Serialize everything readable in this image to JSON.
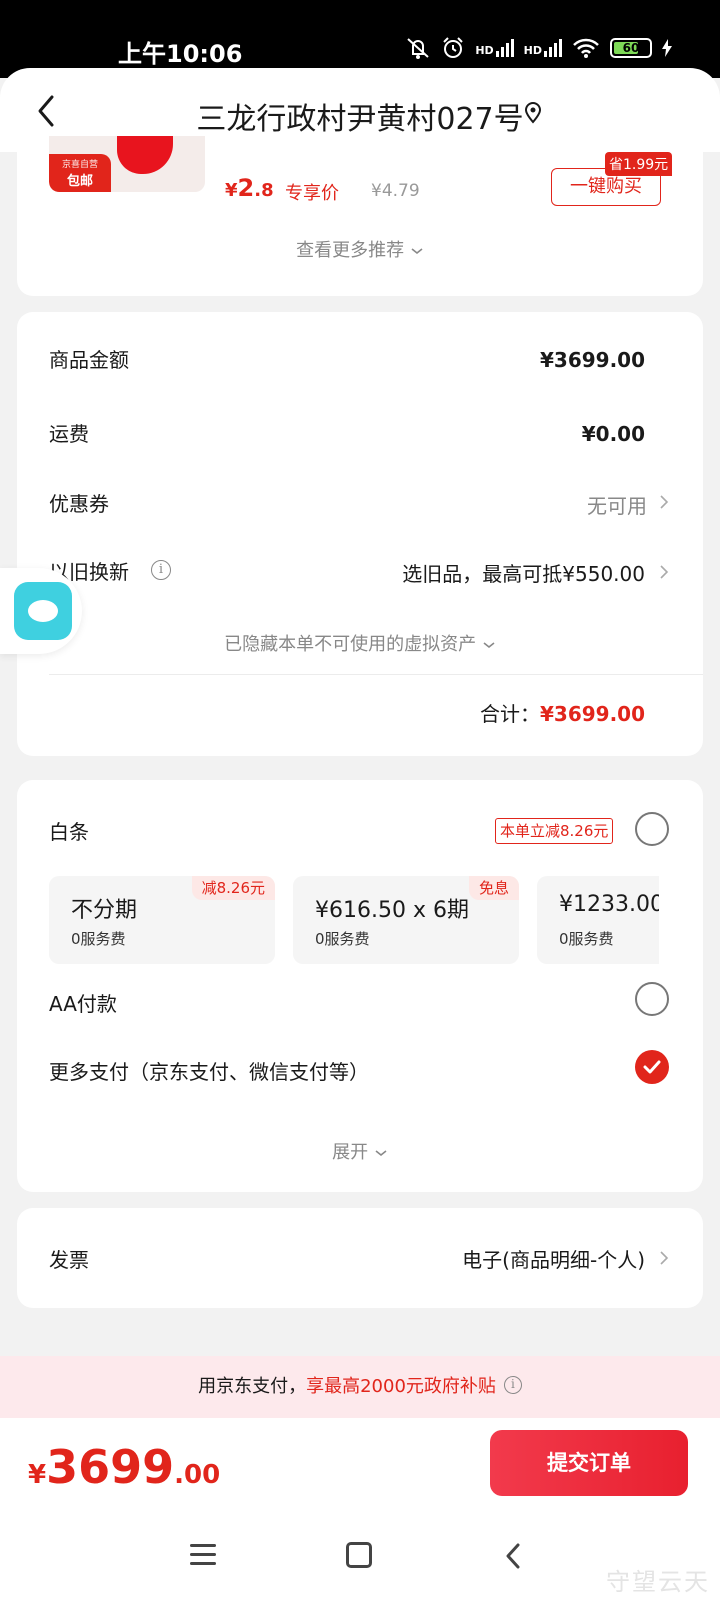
{
  "status_bar": {
    "time": "上午10:06",
    "signal_label_1": "HD",
    "signal_label_2": "HD",
    "battery": "60"
  },
  "header": {
    "title": "三龙行政村尹黄村027号"
  },
  "recommendation": {
    "badge_top": "京喜自营",
    "badge_bottom": "包邮",
    "price_currency": "¥",
    "price_int": "2",
    "price_dec": ".8",
    "price_tag": "专享价",
    "original_price": "¥4.79",
    "save_tag": "省1.99元",
    "buy_button": "一键购买",
    "more": "查看更多推荐"
  },
  "amount": {
    "goods_label": "商品金额",
    "goods_value": "¥3699.00",
    "shipping_label": "运费",
    "shipping_value": "¥0.00",
    "coupon_label": "优惠券",
    "coupon_value": "无可用",
    "tradein_label": "以旧换新",
    "tradein_value": "选旧品，最高可抵¥550.00",
    "hidden_assets": "已隐藏本单不可使用的虚拟资产",
    "total_label": "合计：",
    "total_value": "¥3699.00"
  },
  "payment": {
    "baitiao_label": "白条",
    "baitiao_promo": "本单立减8.26元",
    "plans": [
      {
        "main": "不分期",
        "fee": "0服务费",
        "badge": "减8.26元"
      },
      {
        "main": "¥616.50 x 6期",
        "fee": "0服务费",
        "badge": "免息"
      },
      {
        "main": "¥1233.00",
        "fee": "0服务费",
        "badge": ""
      }
    ],
    "aa_label": "AA付款",
    "more_label": "更多支付（京东支付、微信支付等）",
    "expand": "展开"
  },
  "invoice": {
    "label": "发票",
    "value": "电子(商品明细-个人)"
  },
  "subsidy": {
    "prefix": "用京东支付，",
    "highlight": "享最高2000元政府补贴"
  },
  "bottom": {
    "price_currency": "¥",
    "price_int": "3699",
    "price_dec": ".00",
    "submit": "提交订单"
  },
  "watermark": "守望云天",
  "colors": {
    "accent": "#e1251b",
    "background": "#f2f2f2",
    "subsidy_bg": "#fde9ec"
  }
}
